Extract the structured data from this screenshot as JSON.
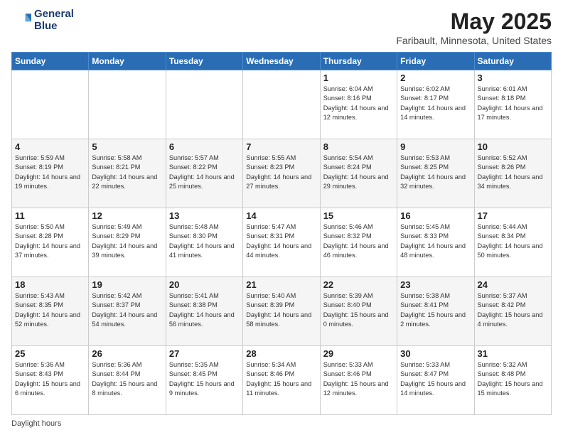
{
  "header": {
    "logo_line1": "General",
    "logo_line2": "Blue",
    "title": "May 2025",
    "subtitle": "Faribault, Minnesota, United States"
  },
  "days_of_week": [
    "Sunday",
    "Monday",
    "Tuesday",
    "Wednesday",
    "Thursday",
    "Friday",
    "Saturday"
  ],
  "weeks": [
    [
      {
        "day": "",
        "info": ""
      },
      {
        "day": "",
        "info": ""
      },
      {
        "day": "",
        "info": ""
      },
      {
        "day": "",
        "info": ""
      },
      {
        "day": "1",
        "info": "Sunrise: 6:04 AM\nSunset: 8:16 PM\nDaylight: 14 hours\nand 12 minutes."
      },
      {
        "day": "2",
        "info": "Sunrise: 6:02 AM\nSunset: 8:17 PM\nDaylight: 14 hours\nand 14 minutes."
      },
      {
        "day": "3",
        "info": "Sunrise: 6:01 AM\nSunset: 8:18 PM\nDaylight: 14 hours\nand 17 minutes."
      }
    ],
    [
      {
        "day": "4",
        "info": "Sunrise: 5:59 AM\nSunset: 8:19 PM\nDaylight: 14 hours\nand 19 minutes."
      },
      {
        "day": "5",
        "info": "Sunrise: 5:58 AM\nSunset: 8:21 PM\nDaylight: 14 hours\nand 22 minutes."
      },
      {
        "day": "6",
        "info": "Sunrise: 5:57 AM\nSunset: 8:22 PM\nDaylight: 14 hours\nand 25 minutes."
      },
      {
        "day": "7",
        "info": "Sunrise: 5:55 AM\nSunset: 8:23 PM\nDaylight: 14 hours\nand 27 minutes."
      },
      {
        "day": "8",
        "info": "Sunrise: 5:54 AM\nSunset: 8:24 PM\nDaylight: 14 hours\nand 29 minutes."
      },
      {
        "day": "9",
        "info": "Sunrise: 5:53 AM\nSunset: 8:25 PM\nDaylight: 14 hours\nand 32 minutes."
      },
      {
        "day": "10",
        "info": "Sunrise: 5:52 AM\nSunset: 8:26 PM\nDaylight: 14 hours\nand 34 minutes."
      }
    ],
    [
      {
        "day": "11",
        "info": "Sunrise: 5:50 AM\nSunset: 8:28 PM\nDaylight: 14 hours\nand 37 minutes."
      },
      {
        "day": "12",
        "info": "Sunrise: 5:49 AM\nSunset: 8:29 PM\nDaylight: 14 hours\nand 39 minutes."
      },
      {
        "day": "13",
        "info": "Sunrise: 5:48 AM\nSunset: 8:30 PM\nDaylight: 14 hours\nand 41 minutes."
      },
      {
        "day": "14",
        "info": "Sunrise: 5:47 AM\nSunset: 8:31 PM\nDaylight: 14 hours\nand 44 minutes."
      },
      {
        "day": "15",
        "info": "Sunrise: 5:46 AM\nSunset: 8:32 PM\nDaylight: 14 hours\nand 46 minutes."
      },
      {
        "day": "16",
        "info": "Sunrise: 5:45 AM\nSunset: 8:33 PM\nDaylight: 14 hours\nand 48 minutes."
      },
      {
        "day": "17",
        "info": "Sunrise: 5:44 AM\nSunset: 8:34 PM\nDaylight: 14 hours\nand 50 minutes."
      }
    ],
    [
      {
        "day": "18",
        "info": "Sunrise: 5:43 AM\nSunset: 8:35 PM\nDaylight: 14 hours\nand 52 minutes."
      },
      {
        "day": "19",
        "info": "Sunrise: 5:42 AM\nSunset: 8:37 PM\nDaylight: 14 hours\nand 54 minutes."
      },
      {
        "day": "20",
        "info": "Sunrise: 5:41 AM\nSunset: 8:38 PM\nDaylight: 14 hours\nand 56 minutes."
      },
      {
        "day": "21",
        "info": "Sunrise: 5:40 AM\nSunset: 8:39 PM\nDaylight: 14 hours\nand 58 minutes."
      },
      {
        "day": "22",
        "info": "Sunrise: 5:39 AM\nSunset: 8:40 PM\nDaylight: 15 hours\nand 0 minutes."
      },
      {
        "day": "23",
        "info": "Sunrise: 5:38 AM\nSunset: 8:41 PM\nDaylight: 15 hours\nand 2 minutes."
      },
      {
        "day": "24",
        "info": "Sunrise: 5:37 AM\nSunset: 8:42 PM\nDaylight: 15 hours\nand 4 minutes."
      }
    ],
    [
      {
        "day": "25",
        "info": "Sunrise: 5:36 AM\nSunset: 8:43 PM\nDaylight: 15 hours\nand 6 minutes."
      },
      {
        "day": "26",
        "info": "Sunrise: 5:36 AM\nSunset: 8:44 PM\nDaylight: 15 hours\nand 8 minutes."
      },
      {
        "day": "27",
        "info": "Sunrise: 5:35 AM\nSunset: 8:45 PM\nDaylight: 15 hours\nand 9 minutes."
      },
      {
        "day": "28",
        "info": "Sunrise: 5:34 AM\nSunset: 8:46 PM\nDaylight: 15 hours\nand 11 minutes."
      },
      {
        "day": "29",
        "info": "Sunrise: 5:33 AM\nSunset: 8:46 PM\nDaylight: 15 hours\nand 12 minutes."
      },
      {
        "day": "30",
        "info": "Sunrise: 5:33 AM\nSunset: 8:47 PM\nDaylight: 15 hours\nand 14 minutes."
      },
      {
        "day": "31",
        "info": "Sunrise: 5:32 AM\nSunset: 8:48 PM\nDaylight: 15 hours\nand 15 minutes."
      }
    ]
  ],
  "footer": {
    "daylight_label": "Daylight hours"
  }
}
